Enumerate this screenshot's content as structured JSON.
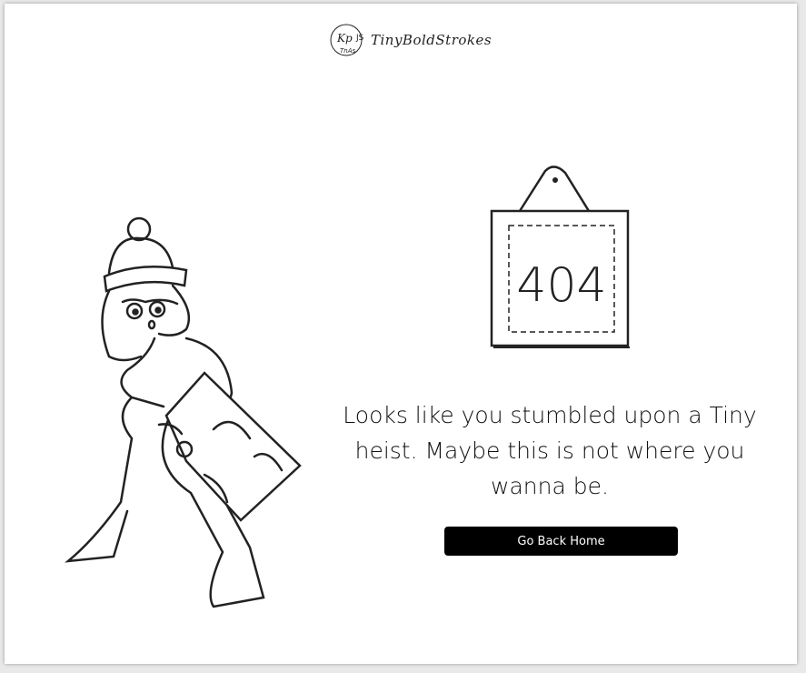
{
  "header": {
    "brand_name": "TinyBoldStrokes",
    "logo_monogram": "TBS"
  },
  "sign": {
    "text": "404"
  },
  "main": {
    "message": "Looks like you stumbled upon a Tiny heist. Maybe this is not where you wanna be.",
    "button_label": "Go Back Home"
  }
}
